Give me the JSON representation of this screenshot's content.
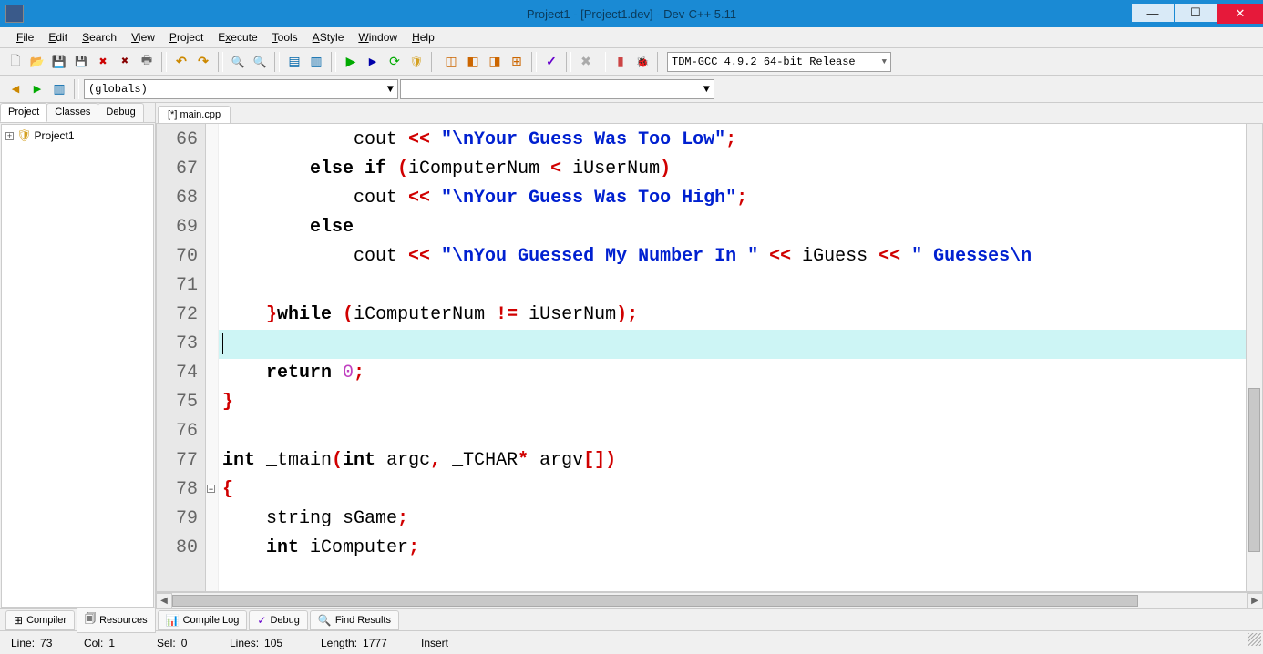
{
  "window": {
    "title": "Project1 - [Project1.dev] - Dev-C++ 5.11"
  },
  "menu": [
    "File",
    "Edit",
    "Search",
    "View",
    "Project",
    "Execute",
    "Tools",
    "AStyle",
    "Window",
    "Help"
  ],
  "toolbar2": {
    "scope_dropdown": "(globals)",
    "member_dropdown": ""
  },
  "compiler_dropdown": "TDM-GCC 4.9.2 64-bit Release",
  "side_tabs": [
    "Project",
    "Classes",
    "Debug"
  ],
  "project_tree": {
    "root": "Project1"
  },
  "editor_tab": "[*] main.cpp",
  "code": {
    "first_line": 66,
    "lines": [
      {
        "n": 66,
        "indent": 4,
        "segs": [
          [
            "",
            "cout"
          ],
          [
            "op",
            " << "
          ],
          [
            "str",
            "\"\\nYour Guess Was Too Low\""
          ],
          [
            "op",
            ";"
          ]
        ]
      },
      {
        "n": 67,
        "indent": 3,
        "segs": [
          [
            "kw",
            "else if "
          ],
          [
            "br",
            "("
          ],
          [
            "",
            "iComputerNum "
          ],
          [
            "op",
            "<"
          ],
          [
            "",
            " iUserNum"
          ],
          [
            "br",
            ")"
          ]
        ]
      },
      {
        "n": 68,
        "indent": 4,
        "segs": [
          [
            "",
            "cout"
          ],
          [
            "op",
            " << "
          ],
          [
            "str",
            "\"\\nYour Guess Was Too High\""
          ],
          [
            "op",
            ";"
          ]
        ]
      },
      {
        "n": 69,
        "indent": 3,
        "segs": [
          [
            "kw",
            "else"
          ]
        ]
      },
      {
        "n": 70,
        "indent": 4,
        "segs": [
          [
            "",
            "cout"
          ],
          [
            "op",
            " << "
          ],
          [
            "str",
            "\"\\nYou Guessed My Number In \""
          ],
          [
            "op",
            " << "
          ],
          [
            "",
            "iGuess"
          ],
          [
            "op",
            " << "
          ],
          [
            "str",
            "\" Guesses\\n"
          ]
        ]
      },
      {
        "n": 71,
        "indent": 0,
        "segs": []
      },
      {
        "n": 72,
        "indent": 2,
        "segs": [
          [
            "br",
            "}"
          ],
          [
            "kw",
            "while "
          ],
          [
            "br",
            "("
          ],
          [
            "",
            "iComputerNum "
          ],
          [
            "op",
            "!="
          ],
          [
            "",
            " iUserNum"
          ],
          [
            "br",
            ")"
          ],
          [
            "op",
            ";"
          ]
        ]
      },
      {
        "n": 73,
        "indent": 0,
        "segs": [],
        "hl": true,
        "cursor": true
      },
      {
        "n": 74,
        "indent": 2,
        "segs": [
          [
            "kw",
            "return "
          ],
          [
            "num",
            "0"
          ],
          [
            "op",
            ";"
          ]
        ]
      },
      {
        "n": 75,
        "indent": 0,
        "segs": [
          [
            "br",
            "}"
          ]
        ]
      },
      {
        "n": 76,
        "indent": 0,
        "segs": []
      },
      {
        "n": 77,
        "indent": 0,
        "segs": [
          [
            "kw",
            "int "
          ],
          [
            "",
            "_tmain"
          ],
          [
            "br",
            "("
          ],
          [
            "kw",
            "int "
          ],
          [
            "",
            "argc"
          ],
          [
            "op",
            ","
          ],
          [
            "",
            " _TCHAR"
          ],
          [
            "op",
            "*"
          ],
          [
            "",
            " argv"
          ],
          [
            "br",
            "[]"
          ],
          [
            "br",
            ")"
          ]
        ]
      },
      {
        "n": 78,
        "indent": 0,
        "segs": [
          [
            "br",
            "{"
          ]
        ],
        "fold": true
      },
      {
        "n": 79,
        "indent": 2,
        "segs": [
          [
            "",
            "string sGame"
          ],
          [
            "op",
            ";"
          ]
        ]
      },
      {
        "n": 80,
        "indent": 2,
        "segs": [
          [
            "kw",
            "int "
          ],
          [
            "",
            "iComputer"
          ],
          [
            "op",
            ";"
          ]
        ]
      }
    ]
  },
  "bottom_tabs": [
    {
      "icon": "⊞",
      "label": "Compiler"
    },
    {
      "icon": "🗐",
      "label": "Resources"
    },
    {
      "icon": "📊",
      "label": "Compile Log"
    },
    {
      "icon": "✓",
      "label": "Debug"
    },
    {
      "icon": "🔍",
      "label": "Find Results"
    }
  ],
  "status": {
    "line_lbl": "Line:",
    "line": "73",
    "col_lbl": "Col:",
    "col": "1",
    "sel_lbl": "Sel:",
    "sel": "0",
    "lines_lbl": "Lines:",
    "lines": "105",
    "length_lbl": "Length:",
    "length": "1777",
    "mode": "Insert"
  }
}
